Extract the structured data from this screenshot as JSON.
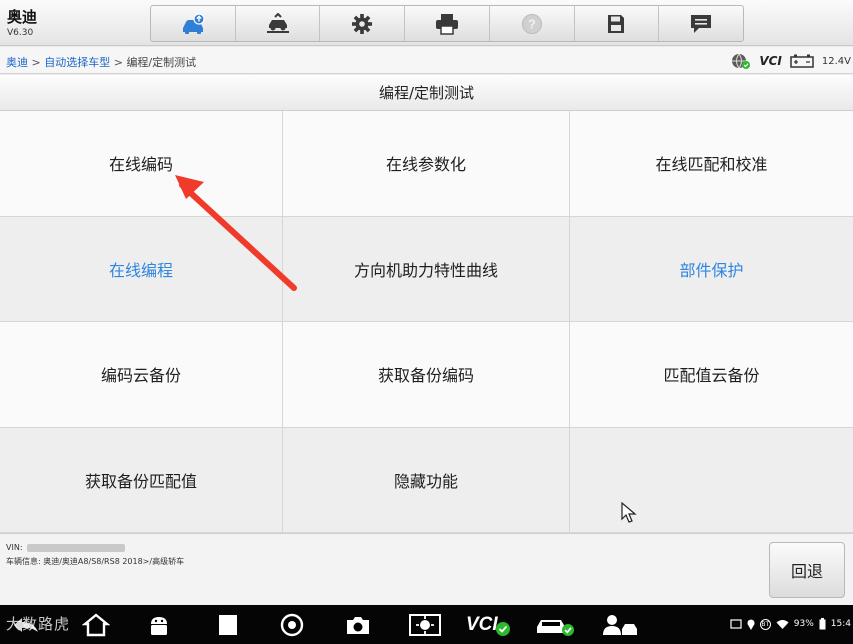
{
  "app": {
    "title": "奥迪",
    "version": "V6.30"
  },
  "toolbar": {
    "buttons": [
      {
        "icon": "car-upload-icon",
        "active": true
      },
      {
        "icon": "vehicle-lift-icon"
      },
      {
        "icon": "gear-icon"
      },
      {
        "icon": "printer-icon"
      },
      {
        "icon": "help-icon",
        "disabled": true
      },
      {
        "icon": "save-icon"
      },
      {
        "icon": "message-icon"
      }
    ]
  },
  "breadcrumb": {
    "item1": "奥迪",
    "item2": "自动选择车型",
    "item3": "编程/定制测试",
    "separator": ">"
  },
  "status": {
    "vci_label": "VCI",
    "battery": "12.4V"
  },
  "section": {
    "title": "编程/定制测试"
  },
  "functions": [
    {
      "label": "在线编码"
    },
    {
      "label": "在线参数化"
    },
    {
      "label": "在线匹配和校准"
    },
    {
      "label": "在线编程",
      "highlight": true
    },
    {
      "label": "方向机助力特性曲线"
    },
    {
      "label": "部件保护",
      "highlight": true
    },
    {
      "label": "编码云备份"
    },
    {
      "label": "获取备份编码"
    },
    {
      "label": "匹配值云备份"
    },
    {
      "label": "获取备份匹配值"
    },
    {
      "label": "隐藏功能"
    },
    {
      "label": ""
    }
  ],
  "info": {
    "vin_label": "VIN:",
    "vehicle_info": "车辆信息: 奥迪/奥迪A8/S8/RS8 2018>/高级轿车"
  },
  "actions": {
    "back_label": "回退"
  },
  "navbar": {
    "watermark": "大数路虎",
    "vci_label": "VCI",
    "battery_percent": "93%",
    "time": "15:4",
    "bt_label": "BT"
  },
  "colors": {
    "link_blue": "#2f86e0",
    "annotation_red": "#f03a2a",
    "status_green": "#2eb82e"
  }
}
